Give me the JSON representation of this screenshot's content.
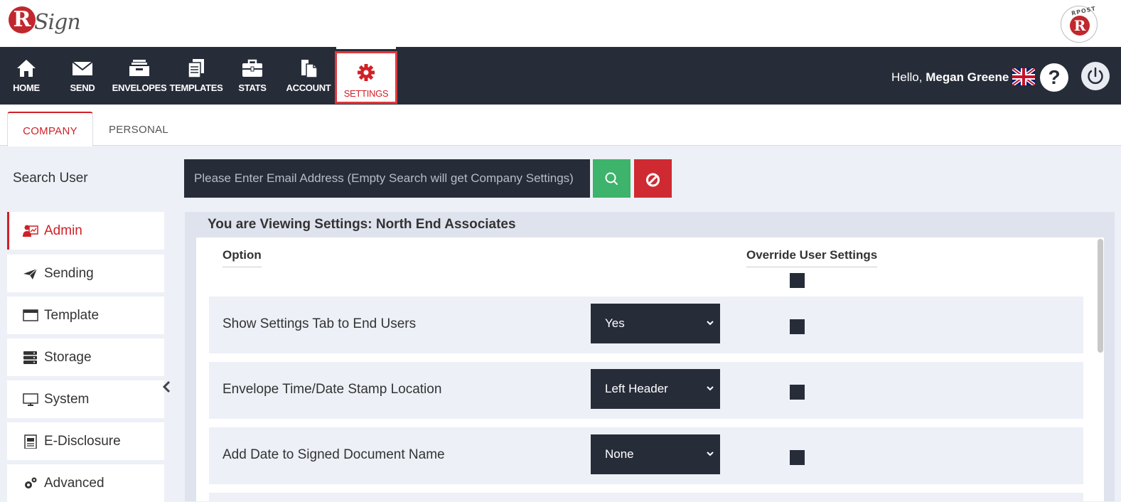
{
  "brand": {
    "logo_letter": "R",
    "logo_text": "Sign",
    "badge_text": "RPOST",
    "badge_letter": "R"
  },
  "nav": {
    "items": [
      {
        "id": "home",
        "label": "HOME",
        "icon": "home-icon"
      },
      {
        "id": "send",
        "label": "SEND",
        "icon": "envelope-icon"
      },
      {
        "id": "envelopes",
        "label": "ENVELOPES",
        "icon": "inbox-icon"
      },
      {
        "id": "templates",
        "label": "TEMPLATES",
        "icon": "documents-icon"
      },
      {
        "id": "stats",
        "label": "STATS",
        "icon": "briefcase-icon"
      },
      {
        "id": "account",
        "label": "ACCOUNT",
        "icon": "document-copy-icon"
      },
      {
        "id": "settings",
        "label": "SETTINGS",
        "icon": "gear-icon",
        "active": true
      }
    ]
  },
  "user": {
    "hello": "Hello,",
    "name": "Megan Greene",
    "help": "?"
  },
  "tabs": [
    {
      "label": "COMPANY",
      "active": true
    },
    {
      "label": "PERSONAL",
      "active": false
    }
  ],
  "search": {
    "label": "Search User",
    "placeholder": "Please Enter Email Address (Empty Search will get Company Settings)"
  },
  "sidebar": {
    "items": [
      {
        "label": "Admin",
        "icon": "admin-user-icon",
        "active": true
      },
      {
        "label": "Sending",
        "icon": "paper-plane-icon"
      },
      {
        "label": "Template",
        "icon": "window-icon"
      },
      {
        "label": "Storage",
        "icon": "server-icon"
      },
      {
        "label": "System",
        "icon": "monitor-icon"
      },
      {
        "label": "E-Disclosure",
        "icon": "document-text-icon"
      },
      {
        "label": "Advanced",
        "icon": "gears-icon"
      }
    ]
  },
  "settings_panel": {
    "title": "You are Viewing Settings: North End Associates",
    "col_option": "Option",
    "col_override": "Override User Settings",
    "rows": [
      {
        "label": "Show Settings Tab to End Users",
        "value": "Yes"
      },
      {
        "label": "Envelope Time/Date Stamp Location",
        "value": "Left Header"
      },
      {
        "label": "Add Date to Signed Document Name",
        "value": "None"
      }
    ]
  },
  "colors": {
    "navbar": "#272c39",
    "accent_red": "#d02027",
    "search_green": "#3db36b",
    "clear_red": "#cf2a32",
    "panel_bg": "#dfe3ee",
    "row_bg": "#edf0f7"
  }
}
